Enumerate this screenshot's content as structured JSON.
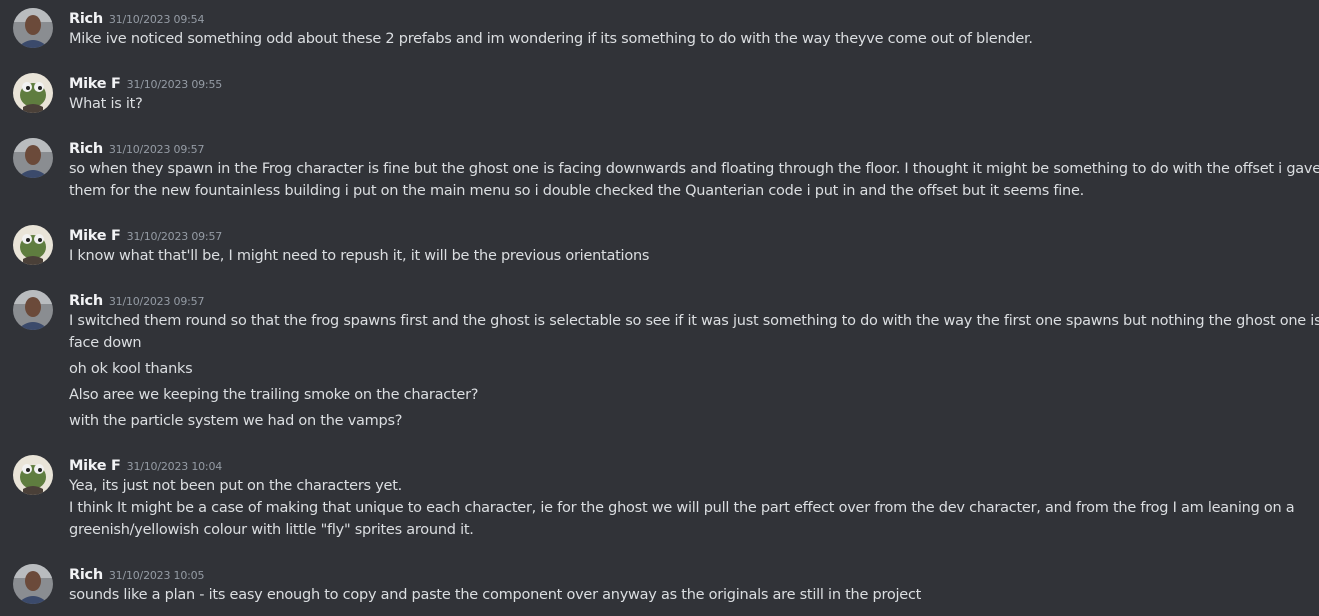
{
  "messages": [
    {
      "author": "Rich",
      "timestamp": "31/10/2023 09:54",
      "lines": [
        "Mike ive noticed something odd about these 2 prefabs and im wondering if its something to do with the way theyve come out of blender."
      ]
    },
    {
      "author": "Mike F",
      "timestamp": "31/10/2023 09:55",
      "lines": [
        "What is it?"
      ]
    },
    {
      "author": "Rich",
      "timestamp": "31/10/2023 09:57",
      "lines": [
        "so when they spawn in the Frog character is fine but the ghost one is facing downwards and floating through the floor. I thought it might be something to do with the offset i gave",
        "them for the new fountainless building i put on the main menu so i double checked the Quanterian code i put in and the offset but it seems fine."
      ]
    },
    {
      "author": "Mike F",
      "timestamp": "31/10/2023 09:57",
      "lines": [
        "I know what that'll be, I might need to repush it, it will be the previous orientations"
      ]
    },
    {
      "author": "Rich",
      "timestamp": "31/10/2023 09:57",
      "lines": [
        "I switched them round so that the frog spawns first and the ghost is selectable so see if it was just something to do with the way the first one spawns but nothing the ghost one is still",
        "face down",
        "oh ok kool thanks",
        "Also aree we keeping the trailing smoke on the character?",
        "with the particle system we had on the vamps?"
      ]
    },
    {
      "author": "Mike F",
      "timestamp": "31/10/2023 10:04",
      "lines": [
        "Yea, its just not been put on the characters yet.",
        "I think It might be a case of making that unique to each character, ie for the ghost we will pull the part effect over from the dev character, and from the frog I am leaning on a",
        "greenish/yellowish colour with little \"fly\" sprites around it."
      ]
    },
    {
      "author": "Rich",
      "timestamp": "31/10/2023 10:05",
      "lines": [
        "sounds like a plan - its easy enough to copy and paste the component over anyway as the originals are still in the project"
      ]
    }
  ],
  "colors": {
    "background": "#313338",
    "author": "#f2f3f5",
    "timestamp": "#949ba4",
    "text": "#dbdee1"
  },
  "icons": {
    "rich_avatar": "person-photo-avatar",
    "mike_avatar": "frog-avatar"
  }
}
